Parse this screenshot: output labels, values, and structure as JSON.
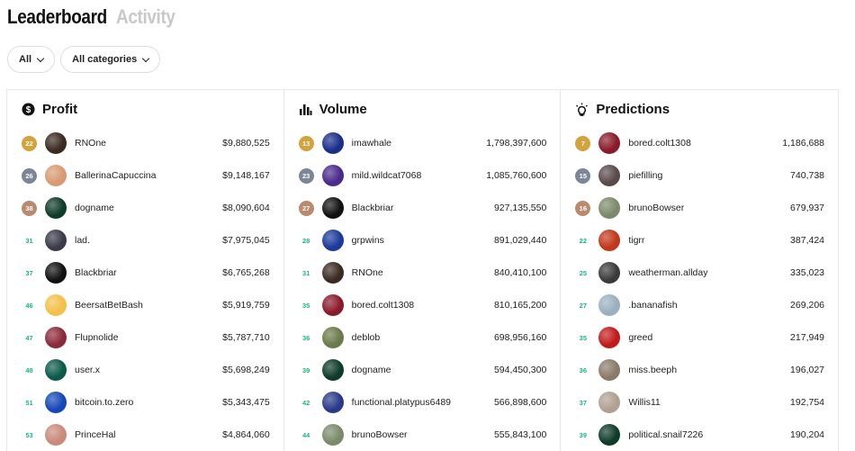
{
  "header": {
    "tab_active": "Leaderboard",
    "tab_inactive": "Activity"
  },
  "filters": {
    "period": "All",
    "category": "All categories"
  },
  "columns": [
    {
      "title": "Profit",
      "icon": "dollar-circle-icon",
      "rows": [
        {
          "rank": "22",
          "badge": "gold",
          "name": "RNOne",
          "value": "$9,880,525",
          "avatar": "#3a2a22"
        },
        {
          "rank": "26",
          "badge": "silver",
          "name": "BallerinaCapuccina",
          "value": "$9,148,167",
          "avatar": "#d89a72"
        },
        {
          "rank": "38",
          "badge": "bronze",
          "name": "dogname",
          "value": "$8,090,604",
          "avatar": "#0f3b2a"
        },
        {
          "rank": "31",
          "badge": "plain",
          "name": "lad.",
          "value": "$7,975,045",
          "avatar": "#3a3a4a"
        },
        {
          "rank": "37",
          "badge": "plain",
          "name": "Blackbriar",
          "value": "$6,765,268",
          "avatar": "#111111"
        },
        {
          "rank": "46",
          "badge": "plain",
          "name": "BeersatBetBash",
          "value": "$5,919,759",
          "avatar": "#f3c04a"
        },
        {
          "rank": "47",
          "badge": "plain",
          "name": "Flupnolide",
          "value": "$5,787,710",
          "avatar": "#8b2a3a"
        },
        {
          "rank": "48",
          "badge": "plain",
          "name": "user.x",
          "value": "$5,698,249",
          "avatar": "#0b5a4a"
        },
        {
          "rank": "51",
          "badge": "plain",
          "name": "bitcoin.to.zero",
          "value": "$5,343,475",
          "avatar": "#1547b8"
        },
        {
          "rank": "53",
          "badge": "plain",
          "name": "PrinceHal",
          "value": "$4,864,060",
          "avatar": "#c98a7a"
        }
      ]
    },
    {
      "title": "Volume",
      "icon": "bar-chart-icon",
      "rows": [
        {
          "rank": "13",
          "badge": "gold",
          "name": "imawhale",
          "value": "1,798,397,600",
          "avatar": "#1a2f8a"
        },
        {
          "rank": "23",
          "badge": "silver",
          "name": "mild.wildcat7068",
          "value": "1,085,760,600",
          "avatar": "#4a2a8a"
        },
        {
          "rank": "27",
          "badge": "bronze",
          "name": "Blackbriar",
          "value": "927,135,550",
          "avatar": "#111111"
        },
        {
          "rank": "28",
          "badge": "plain",
          "name": "grpwins",
          "value": "891,029,440",
          "avatar": "#1b3a9a"
        },
        {
          "rank": "31",
          "badge": "plain",
          "name": "RNOne",
          "value": "840,410,100",
          "avatar": "#3a2a22"
        },
        {
          "rank": "35",
          "badge": "plain",
          "name": "bored.colt1308",
          "value": "810,165,200",
          "avatar": "#8a1a2a"
        },
        {
          "rank": "36",
          "badge": "plain",
          "name": "deblob",
          "value": "698,956,160",
          "avatar": "#6a7a4a"
        },
        {
          "rank": "39",
          "badge": "plain",
          "name": "dogname",
          "value": "594,450,300",
          "avatar": "#0f3b2a"
        },
        {
          "rank": "42",
          "badge": "plain",
          "name": "functional.platypus6489",
          "value": "566,898,600",
          "avatar": "#2a3a8a"
        },
        {
          "rank": "44",
          "badge": "plain",
          "name": "brunoBowser",
          "value": "555,843,100",
          "avatar": "#7a8a6a"
        }
      ]
    },
    {
      "title": "Predictions",
      "icon": "lightbulb-icon",
      "rows": [
        {
          "rank": "7",
          "badge": "gold",
          "name": "bored.colt1308",
          "value": "1,186,688",
          "avatar": "#8a1a2a"
        },
        {
          "rank": "15",
          "badge": "silver",
          "name": "piefilling",
          "value": "740,738",
          "avatar": "#5a4a4a"
        },
        {
          "rank": "16",
          "badge": "bronze",
          "name": "brunoBowser",
          "value": "679,937",
          "avatar": "#7a8a6a"
        },
        {
          "rank": "22",
          "badge": "plain",
          "name": "tigrr",
          "value": "387,424",
          "avatar": "#c2361a"
        },
        {
          "rank": "25",
          "badge": "plain",
          "name": "weatherman.allday",
          "value": "335,023",
          "avatar": "#3a3a3a"
        },
        {
          "rank": "27",
          "badge": "plain",
          "name": ".bananafish",
          "value": "269,206",
          "avatar": "#9ab0c0"
        },
        {
          "rank": "35",
          "badge": "plain",
          "name": "greed",
          "value": "217,949",
          "avatar": "#c21a1a"
        },
        {
          "rank": "36",
          "badge": "plain",
          "name": "miss.beeph",
          "value": "196,027",
          "avatar": "#8a7a6a"
        },
        {
          "rank": "37",
          "badge": "plain",
          "name": "Willis11",
          "value": "192,754",
          "avatar": "#b0a090"
        },
        {
          "rank": "39",
          "badge": "plain",
          "name": "political.snail7226",
          "value": "190,204",
          "avatar": "#0f3b2a"
        }
      ]
    }
  ]
}
